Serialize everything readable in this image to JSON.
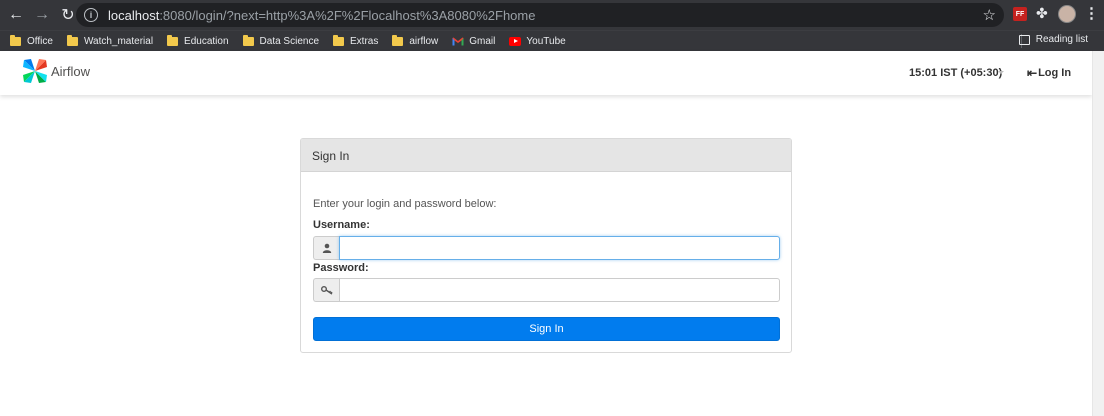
{
  "browser": {
    "url_host": "localhost",
    "url_rest": ":8080/login/?next=http%3A%2F%2Flocalhost%3A8080%2Fhome",
    "ext_ff_label": "FF",
    "bookmarks": [
      {
        "label": "Office",
        "icon": "folder-icon"
      },
      {
        "label": "Watch_material",
        "icon": "folder-icon"
      },
      {
        "label": "Education",
        "icon": "folder-icon"
      },
      {
        "label": "Data Science",
        "icon": "folder-icon"
      },
      {
        "label": "Extras",
        "icon": "folder-icon"
      },
      {
        "label": "airflow",
        "icon": "folder-icon"
      },
      {
        "label": "Gmail",
        "icon": "gmail-icon"
      },
      {
        "label": "YouTube",
        "icon": "youtube-icon"
      }
    ],
    "reading_list": "Reading list"
  },
  "navbar": {
    "brand": "Airflow",
    "clock": "15:01 IST (+05:30)",
    "login": "Log In"
  },
  "login_panel": {
    "heading": "Sign In",
    "instruction": "Enter your login and password below:",
    "username_label": "Username:",
    "username_value": "",
    "password_label": "Password:",
    "password_value": "",
    "submit": "Sign In"
  },
  "colors": {
    "primary": "#017cee",
    "panel_heading_bg": "#e5e5e5",
    "browser_chrome": "#35363a"
  }
}
